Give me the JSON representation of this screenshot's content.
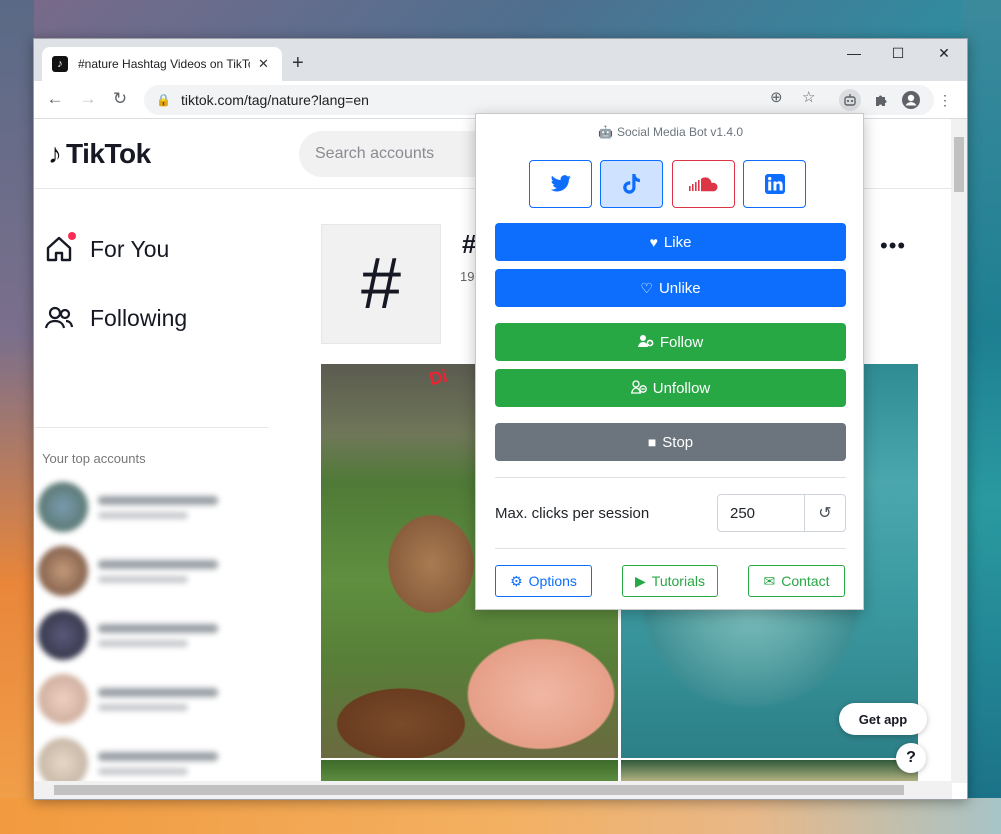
{
  "browser": {
    "tab_title": "#nature Hashtag Videos on TikTok",
    "new_tab_symbol": "+",
    "url": "tiktok.com/tag/nature?lang=en",
    "window_controls": {
      "minimize": "—",
      "maximize": "☐",
      "close": "✕"
    }
  },
  "tiktok": {
    "logo_text": "TikTok",
    "search_placeholder": "Search accounts",
    "nav": [
      {
        "label": "For You",
        "icon": "home-icon"
      },
      {
        "label": "Following",
        "icon": "users-icon"
      }
    ],
    "top_accounts_heading": "Your top accounts",
    "hashtag_symbol": "#",
    "hashtag_title": "#",
    "hashtag_sub": "19",
    "more_symbol": "•••",
    "video_sign_text": "Di",
    "get_app": "Get app",
    "help": "?"
  },
  "popup": {
    "title": "Social Media Bot v1.4.0",
    "networks": [
      {
        "name": "twitter",
        "active": false
      },
      {
        "name": "tiktok",
        "active": true
      },
      {
        "name": "soundcloud",
        "active": false
      },
      {
        "name": "linkedin",
        "active": false
      }
    ],
    "like_label": "Like",
    "unlike_label": "Unlike",
    "follow_label": "Follow",
    "unfollow_label": "Unfollow",
    "stop_label": "Stop",
    "max_clicks_label": "Max. clicks per session",
    "max_clicks_value": "250",
    "options_label": "Options",
    "tutorials_label": "Tutorials",
    "contact_label": "Contact"
  },
  "colors": {
    "primary": "#0d6efd",
    "success": "#28a745",
    "secondary": "#6c757d",
    "tiktok_red": "#fe2c55"
  }
}
